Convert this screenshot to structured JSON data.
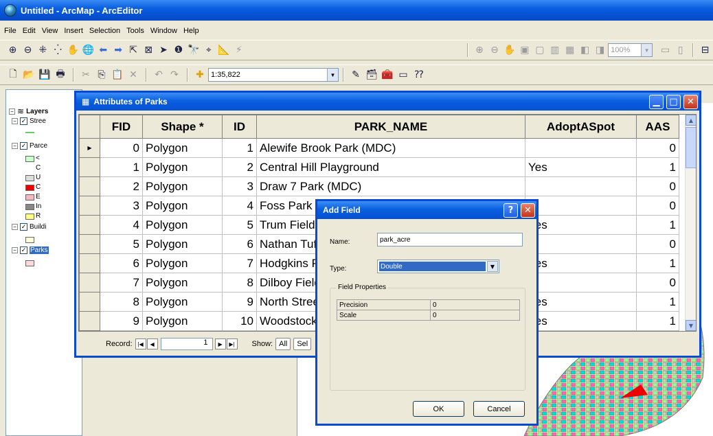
{
  "app": {
    "title": "Untitled - ArcMap - ArcEditor"
  },
  "menu": [
    "File",
    "Edit",
    "View",
    "Insert",
    "Selection",
    "Tools",
    "Window",
    "Help"
  ],
  "toolbar": {
    "zoom_value": "100%",
    "scale_value": "1:35,822"
  },
  "toc": {
    "layers_label": "Layers",
    "items": [
      {
        "label": "Stree",
        "checked": true
      },
      {
        "label": "Parce",
        "checked": true
      },
      {
        "label": "Buildi",
        "checked": true
      },
      {
        "label": "Parks",
        "checked": true,
        "selected": true
      }
    ],
    "symbol_labels": [
      "<",
      "C",
      "U",
      "C",
      "E",
      "In",
      "R"
    ]
  },
  "attr_window": {
    "title": "Attributes of Parks",
    "columns": [
      "FID",
      "Shape *",
      "ID",
      "PARK_NAME",
      "AdoptASpot",
      "AAS"
    ],
    "rows": [
      [
        "0",
        "Polygon",
        "1",
        "Alewife Brook Park (MDC)",
        "",
        "0"
      ],
      [
        "1",
        "Polygon",
        "2",
        "Central Hill Playground",
        "Yes",
        "1"
      ],
      [
        "2",
        "Polygon",
        "3",
        "Draw 7 Park (MDC)",
        "",
        "0"
      ],
      [
        "3",
        "Polygon",
        "4",
        "Foss Park (MDC)",
        "",
        "0"
      ],
      [
        "4",
        "Polygon",
        "5",
        "Trum Field",
        "Yes",
        "1"
      ],
      [
        "5",
        "Polygon",
        "6",
        "Nathan Tufts Park",
        "",
        "0"
      ],
      [
        "6",
        "Polygon",
        "7",
        "Hodgkins Park",
        "Yes",
        "1"
      ],
      [
        "7",
        "Polygon",
        "8",
        "Dilboy Field",
        "",
        "0"
      ],
      [
        "8",
        "Polygon",
        "9",
        "North Street Playground",
        "Yes",
        "1"
      ],
      [
        "9",
        "Polygon",
        "10",
        "Woodstock Playground",
        "Yes",
        "1"
      ]
    ],
    "record_label": "Record:",
    "record_value": "1",
    "show_label": "Show:",
    "show_all": "All",
    "show_selected": "Sel",
    "options_label": "ons"
  },
  "dialog": {
    "title": "Add Field",
    "name_label": "Name:",
    "name_value": "park_acre",
    "type_label": "Type:",
    "type_value": "Double",
    "field_props_label": "Field Properties",
    "props": [
      {
        "name": "Precision",
        "value": "0"
      },
      {
        "name": "Scale",
        "value": "0"
      }
    ],
    "ok": "OK",
    "cancel": "Cancel"
  }
}
